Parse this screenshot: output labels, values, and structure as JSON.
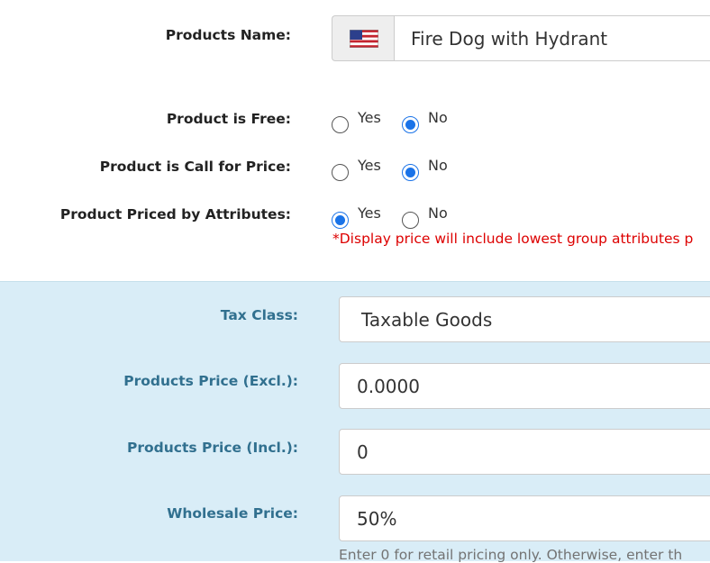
{
  "product_name": {
    "label": "Products Name:",
    "flag_icon": "us-flag-icon",
    "value": "Fire Dog with Hydrant"
  },
  "free": {
    "label": "Product is Free:",
    "options": [
      {
        "label": "Yes",
        "checked": false
      },
      {
        "label": "No",
        "checked": true
      }
    ]
  },
  "call_for_price": {
    "label": "Product is Call for Price:",
    "options": [
      {
        "label": "Yes",
        "checked": false
      },
      {
        "label": "No",
        "checked": true
      }
    ]
  },
  "priced_by_attributes": {
    "label": "Product Priced by Attributes:",
    "options": [
      {
        "label": "Yes",
        "checked": true
      },
      {
        "label": "No",
        "checked": false
      }
    ],
    "note": "*Display price will include lowest group attributes p"
  },
  "tax_panel": {
    "background": "#d9edf7",
    "tax_class": {
      "label": "Tax Class:",
      "value": "Taxable Goods"
    },
    "price_excl": {
      "label": "Products Price (Excl.):",
      "value": "0.0000"
    },
    "price_incl": {
      "label": "Products Price (Incl.):",
      "value": "0"
    },
    "wholesale": {
      "label": "Wholesale Price:",
      "value": "50%",
      "help": "Enter 0 for retail pricing only. Otherwise, enter th"
    }
  }
}
